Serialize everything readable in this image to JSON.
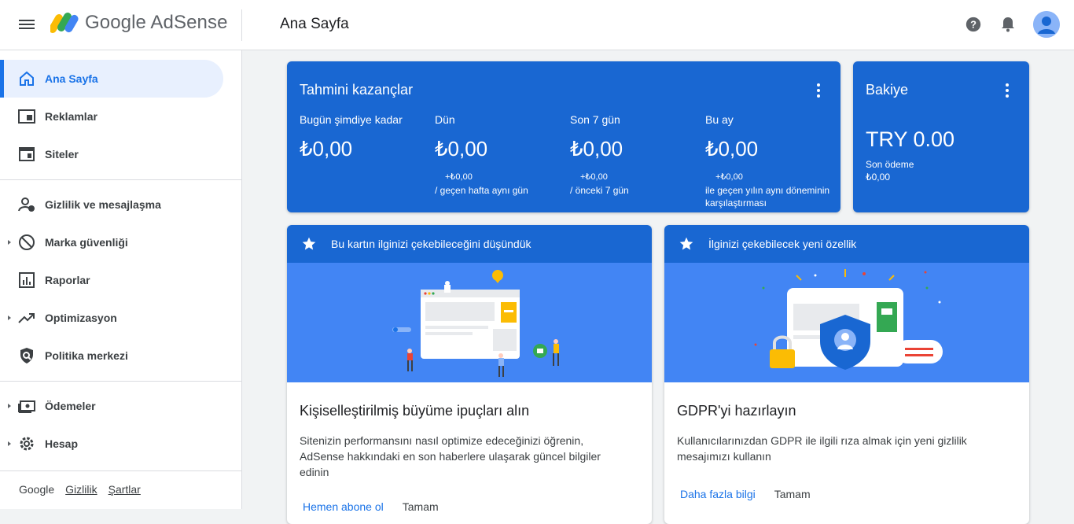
{
  "header": {
    "logo_text": "Google AdSense",
    "page_title": "Ana Sayfa",
    "icons": [
      "menu-icon",
      "help-icon",
      "notifications-icon",
      "account-avatar"
    ]
  },
  "sidebar": {
    "items": [
      {
        "label": "Ana Sayfa",
        "icon": "home-icon",
        "active": true
      },
      {
        "label": "Reklamlar",
        "icon": "ads-icon"
      },
      {
        "label": "Siteler",
        "icon": "sites-icon"
      },
      {
        "label": "Gizlilik ve mesajlaşma",
        "icon": "privacy-icon"
      },
      {
        "label": "Marka güvenliği",
        "icon": "block-icon",
        "expandable": true
      },
      {
        "label": "Raporlar",
        "icon": "reports-icon"
      },
      {
        "label": "Optimizasyon",
        "icon": "trending-icon",
        "expandable": true
      },
      {
        "label": "Politika merkezi",
        "icon": "policy-icon"
      },
      {
        "label": "Ödemeler",
        "icon": "payments-icon",
        "expandable": true
      },
      {
        "label": "Hesap",
        "icon": "settings-icon",
        "expandable": true
      }
    ],
    "footer": {
      "brand": "Google",
      "privacy": "Gizlilik",
      "terms": "Şartlar"
    }
  },
  "earnings": {
    "title": "Tahmini kazançlar",
    "stats": [
      {
        "label": "Bugün şimdiye kadar",
        "value": "₺0,00",
        "cmp1": "",
        "cmp2": ""
      },
      {
        "label": "Dün",
        "value": "₺0,00",
        "cmp1": "+₺0,00",
        "cmp2": "/ geçen hafta aynı gün"
      },
      {
        "label": "Son 7 gün",
        "value": "₺0,00",
        "cmp1": "+₺0,00",
        "cmp2": "/ önceki 7 gün"
      },
      {
        "label": "Bu ay",
        "value": "₺0,00",
        "cmp1": "+₺0,00",
        "cmp2": "ile geçen yılın aynı döneminin karşılaştırması"
      }
    ]
  },
  "balance": {
    "title": "Bakiye",
    "value": "TRY 0.00",
    "last_payment_label": "Son ödeme",
    "last_payment_value": "₺0,00"
  },
  "card1": {
    "header": "Bu kartın ilginizi çekebileceğini düşündük",
    "title": "Kişiselleştirilmiş büyüme ipuçları alın",
    "body": "Sitenizin performansını nasıl optimize edeceğinizi öğrenin, AdSense hakkındaki en son haberlere ulaşarak güncel bilgiler edinin",
    "primary_action": "Hemen abone ol",
    "secondary_action": "Tamam"
  },
  "card2": {
    "header": "İlginizi çekebilecek yeni özellik",
    "title": "GDPR'yi hazırlayın",
    "body": "Kullanıcılarınızdan GDPR ile ilgili rıza almak için yeni gizlilik mesajımızı kullanın",
    "primary_action": "Daha fazla bilgi",
    "secondary_action": "Tamam"
  },
  "colors": {
    "brand_blue": "#1967d2",
    "accent": "#1a73e8",
    "illustration_bg": "#4285f4"
  }
}
